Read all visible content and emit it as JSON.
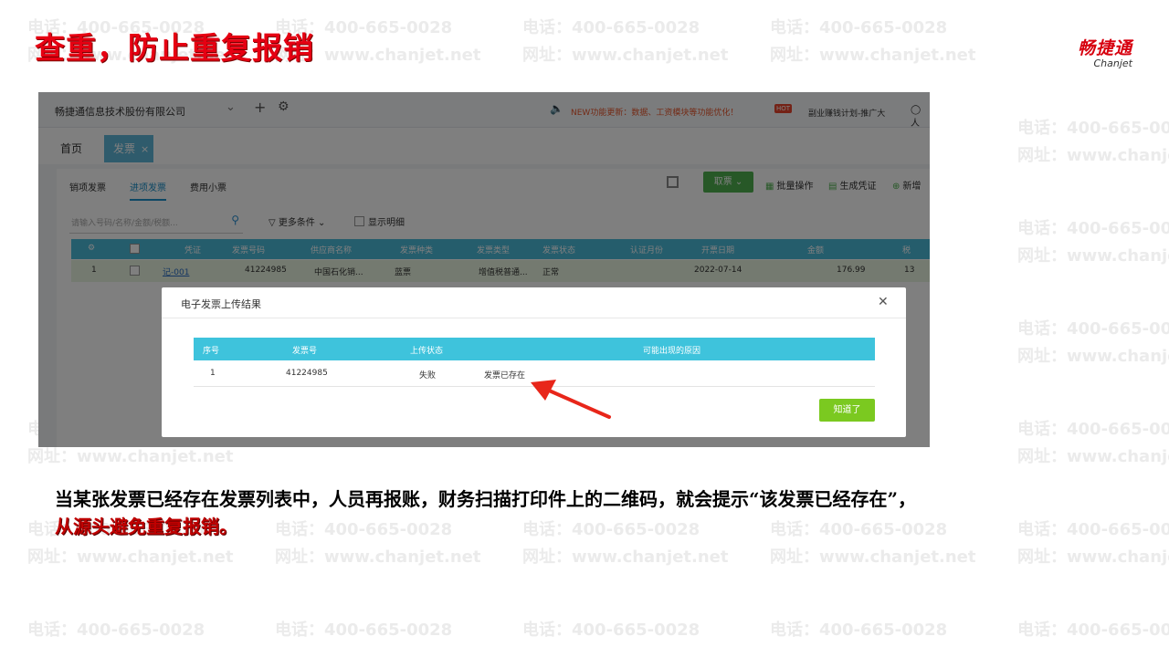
{
  "slide": {
    "title": "查重，防止重复报销",
    "brand_cn": "畅捷通",
    "brand_en": "Chanjet",
    "watermark_phone": "电话：400-665-0028",
    "watermark_site": "网址：www.chanjet.net",
    "description": "当某张发票已经存在发票列表中，人员再报账，财务扫描打印件上的二维码，就会提示“该发票已经存在”，",
    "description_red": "从源头避免重复报销。"
  },
  "app": {
    "company": "畅捷通信息技术股份有限公司",
    "news": "NEW功能更新：数据、工资模块等功能优化！",
    "hot_badge": "HOT",
    "promo": "副业赚钱计划-推广大",
    "headset_label": "人",
    "tabs": {
      "home": "首页",
      "invoice": "发票"
    },
    "subtabs": [
      "销项发票",
      "进项发票",
      "费用小票"
    ],
    "actions": {
      "collect": "取票",
      "batch": "批量操作",
      "voucher": "生成凭证",
      "add": "新增"
    },
    "search_placeholder": "请输入号码/名称/金额/税额...",
    "filter_label": "更多条件",
    "show_detail": "显示明细",
    "table_headers": [
      "凭证",
      "发票号码",
      "供应商名称",
      "发票种类",
      "发票类型",
      "发票状态",
      "认证月份",
      "开票日期",
      "金额",
      "税"
    ],
    "table_row": {
      "index": "1",
      "voucher": "记-001",
      "invoice_no": "41224985",
      "supplier": "中国石化销...",
      "kind": "蓝票",
      "type": "增值税普通...",
      "status": "正常",
      "auth_month": "",
      "date": "2022-07-14",
      "amount": "176.99",
      "tax": "13"
    }
  },
  "modal": {
    "title": "电子发票上传结果",
    "headers": [
      "序号",
      "发票号",
      "上传状态",
      "可能出现的原因"
    ],
    "row": {
      "index": "1",
      "invoice_no": "41224985",
      "status": "失败",
      "reason": "发票已存在"
    },
    "ok_label": "知道了"
  }
}
